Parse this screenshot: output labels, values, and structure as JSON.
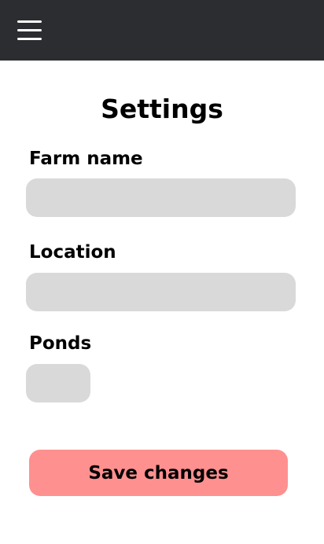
{
  "header": {
    "menu_icon": "hamburger-menu-icon",
    "background_color": "#2b2d31"
  },
  "page": {
    "title": "Settings"
  },
  "form": {
    "farm_name": {
      "label": "Farm name",
      "value": "",
      "placeholder": ""
    },
    "location": {
      "label": "Location",
      "value": "",
      "placeholder": ""
    },
    "ponds": {
      "label": "Ponds",
      "value": "",
      "placeholder": ""
    },
    "field_color": "#d9d9d9"
  },
  "actions": {
    "save_label": "Save changes",
    "save_color": "#ff9090"
  }
}
